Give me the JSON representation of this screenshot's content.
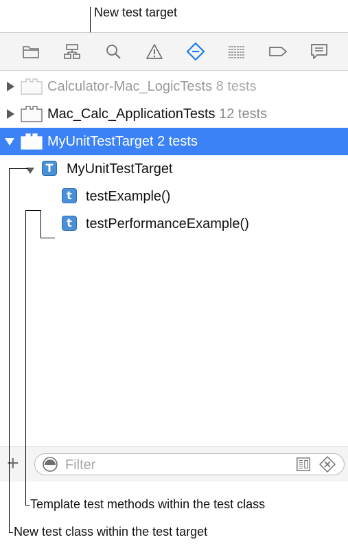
{
  "callouts": {
    "new_test_target": "New test target",
    "template_methods": "Template test methods within the test class",
    "new_test_class": "New test class within the test target"
  },
  "toolbar": {
    "icons": [
      "folder-icon",
      "hierarchy-icon",
      "search-icon",
      "warning-icon",
      "test-navigator-icon",
      "list-icon",
      "breakpoint-icon",
      "report-icon"
    ],
    "active_icon": "test-navigator-icon",
    "active_color": "#1a7cf0"
  },
  "tree": {
    "rows": [
      {
        "name": "Calculator-Mac_LogicTests",
        "count": "8 tests"
      },
      {
        "name": "Mac_Calc_ApplicationTests",
        "count": "12 tests"
      },
      {
        "name": "MyUnitTestTarget",
        "count": "2 tests"
      },
      {
        "name": "MyUnitTestTarget",
        "badge": "T"
      },
      {
        "name": "testExample()",
        "badge": "t"
      },
      {
        "name": "testPerformanceExample()",
        "badge": "t"
      }
    ]
  },
  "filter": {
    "placeholder": "Filter",
    "add_symbol": "+"
  },
  "colors": {
    "selection": "#3b82f6",
    "test_badge": "#4a90d9"
  }
}
